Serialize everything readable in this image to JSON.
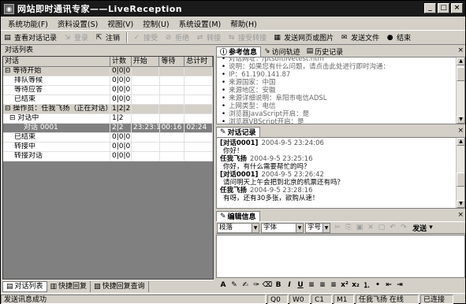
{
  "window": {
    "title": "网站即时通讯专家——LiveReception"
  },
  "menu": [
    "系统功能(F)",
    "资料设置(S)",
    "视图(V)",
    "控制(U)",
    "系统设置(M)",
    "帮助(H)"
  ],
  "toolbar": {
    "view_log": "查看对话记录",
    "login": "登录",
    "logout": "注销",
    "accept": "接受",
    "reject": "拒绝",
    "transfer": "转接",
    "accept_transfer": "接受转接",
    "send_page": "发送网页或图片",
    "send_file": "发送文件",
    "end": "结束"
  },
  "left": {
    "title": "对话列表",
    "columns": [
      "对话",
      "计数",
      "开始",
      "等待",
      "总计时"
    ],
    "rows": [
      {
        "label": "⊟ 等待开始",
        "count": "0|0|0",
        "start": "",
        "wait": "",
        "total": "",
        "kind": "grp"
      },
      {
        "label": "排队等候",
        "count": "0|0|0",
        "start": "",
        "wait": "",
        "total": "",
        "kind": "child"
      },
      {
        "label": "等待应答",
        "count": "0|0|0",
        "start": "",
        "wait": "",
        "total": "",
        "kind": "child"
      },
      {
        "label": "已结束",
        "count": "0|0|0",
        "start": "",
        "wait": "",
        "total": "",
        "kind": "child"
      },
      {
        "label": "⊟ 操作员：任我飞扬（正在对话）",
        "count": "1|2|2",
        "start": "",
        "wait": "",
        "total": "",
        "kind": "grp"
      },
      {
        "label": "⊟ 对话中",
        "count": "1|2",
        "start": "",
        "wait": "",
        "total": "",
        "kind": "child1"
      },
      {
        "label": "对话 0001",
        "count": "2|2",
        "start": "23:23:14",
        "wait": "00:16",
        "total": "02:24",
        "kind": "sel"
      },
      {
        "label": "已结束",
        "count": "0|0|0",
        "start": "",
        "wait": "",
        "total": "",
        "kind": "child"
      },
      {
        "label": "转接中",
        "count": "0|0|0",
        "start": "",
        "wait": "",
        "total": "",
        "kind": "child"
      },
      {
        "label": "转接对话",
        "count": "0|0|0",
        "start": "",
        "wait": "",
        "total": "",
        "kind": "child"
      }
    ],
    "tabs": [
      "对话列表",
      "快捷回复",
      "快捷回复查询"
    ]
  },
  "info_panel": {
    "tabs": [
      "参考信息",
      "访问轨迹",
      "历史记录"
    ],
    "items": [
      "对话网址：/ptsoftlivetest.htm",
      "说明：如果您有什么问题，请点击此处进行即时沟通：",
      "IP：61.190.141.87",
      "来源国家：中国",
      "来源地区：安徽",
      "来源详细说明：阜阳市电信ADSL",
      "上网类型：电信",
      "浏览器JavaScript开启：是",
      "浏览器VBScript开启：是"
    ]
  },
  "chat_panel": {
    "tab": "对话记录",
    "messages": [
      {
        "who": "[对话0001]",
        "time": "2004-9-5 23:24:06",
        "text": "你好！"
      },
      {
        "who": "任我飞扬",
        "time": "2004-9-5 23:25:16",
        "text": "你好，有什么需要帮忙的吗？"
      },
      {
        "who": "[对话0001]",
        "time": "2004-9-5 23:26:42",
        "text": "请问明天上午会把到北京的机票还有吗？"
      },
      {
        "who": "任我飞扬",
        "time": "2004-9-5 23:28:16",
        "text": "有呀，还有30多张，欲购从速！"
      }
    ]
  },
  "edit_panel": {
    "tab": "编辑信息",
    "paragraph": "段落",
    "font": "字体",
    "size": "字号",
    "send": "发送"
  },
  "status": {
    "msg": "发送讯息成功",
    "q": "Q0",
    "w": "W0",
    "c": "C1",
    "m": "M1",
    "user": "任我飞扬 在线",
    "conn": "已连接"
  }
}
